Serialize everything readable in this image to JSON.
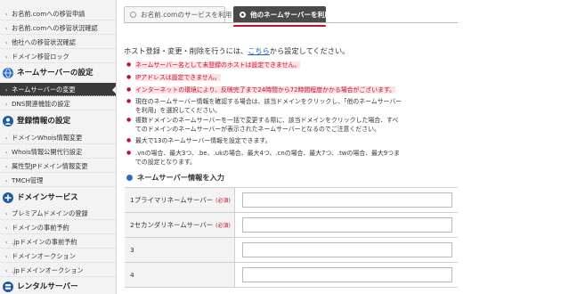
{
  "sidebar": {
    "top_items": [
      {
        "label": "お名前.comへの移管申請"
      },
      {
        "label": "お名前.comへの移管状況確認"
      },
      {
        "label": "他社への移管状況確認"
      },
      {
        "label": "ドメイン移管ロック"
      }
    ],
    "section_ns": {
      "label": "ネームサーバーの設定",
      "icon": "globe-icon",
      "color": "#2c6fc1"
    },
    "ns_items": [
      {
        "label": "ネームサーバーの変更"
      },
      {
        "label": "DNS関連機能の設定"
      }
    ],
    "section_reg": {
      "label": "登録情報の設定",
      "icon": "user-icon",
      "color": "#1f5aa6"
    },
    "reg_items": [
      {
        "label": "ドメインWhois情報変更"
      },
      {
        "label": "Whois情報公開代行設定"
      },
      {
        "label": "属性型JPドメイン情報変更"
      },
      {
        "label": "TMCH管理"
      }
    ],
    "section_ds": {
      "label": "ドメインサービス",
      "icon": "plus-circle-icon",
      "color": "#1f5aa6"
    },
    "ds_items": [
      {
        "label": "プレミアムドメインの登録"
      },
      {
        "label": "ドメインの事前予約"
      },
      {
        "label": ".jpドメインの事前予約"
      },
      {
        "label": "ドメインオークション"
      },
      {
        "label": ".jpドメインオークション"
      }
    ],
    "section_rs": {
      "label": "レンタルサーバー",
      "icon": "server-icon",
      "color": "#1f5aa6"
    }
  },
  "tabs": {
    "tab1": "お名前.comのサービスを利用",
    "tab2": "他のネームサーバーを利用"
  },
  "intro": {
    "before": "ホスト登録・変更・削除を行うには、",
    "link": "こちら",
    "after": "から設定してください。"
  },
  "notes": [
    "ネームサーバー名として未登録のホストは設定できません。",
    "IPアドレスは設定できません。",
    "インターネットの環境により、反映完了まで24時間から72時間程度かかる場合がございます。",
    "現在のネームサーバー情報を確認する場合は、該当ドメインをクリックし、「他のネームサーバーを利用」を選択してください。",
    "複数ドメインのネームサーバーを一括で変更する際に、該当ドメインをクリックした場合、すべてのドメインのネームサーバーが表示されたネームサーバーとなるのでご注意ください。",
    "最大で13のネームサーバー情報を設定できます。",
    ".vnの場合、最大3つ、.be、.ukの場合、最大4つ、.cnの場合、最大7つ、.twの場合、最大9つまでの設定となります。"
  ],
  "section_title": "ネームサーバー情報を入力",
  "ns_rows": [
    {
      "label": "1プライマリネームサーバー",
      "required": "(必須)",
      "value": ""
    },
    {
      "label": "2セカンダリネームサーバー",
      "required": "(必須)",
      "value": ""
    },
    {
      "label": "3",
      "required": "",
      "value": ""
    },
    {
      "label": "4",
      "required": "",
      "value": ""
    }
  ],
  "colors": {
    "accent_red": "#c8102e",
    "link_blue": "#1a5fb4",
    "active_tab": "#4a4a4a"
  }
}
